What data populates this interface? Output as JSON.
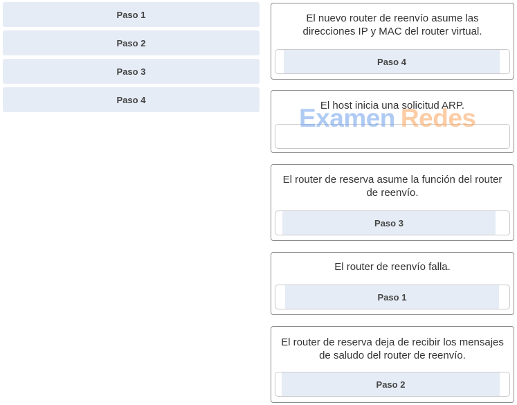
{
  "source_items": [
    {
      "label": "Paso 1"
    },
    {
      "label": "Paso 2"
    },
    {
      "label": "Paso 3"
    },
    {
      "label": "Paso 4"
    }
  ],
  "targets": [
    {
      "text": "El nuevo router de reenvío asume las direcciones IP y MAC del router virtual.",
      "answer": "Paso 4"
    },
    {
      "text": "El host inicia una solicitud ARP.",
      "answer": ""
    },
    {
      "text": "El router de reserva asume la función del router de reenvío.",
      "answer": "Paso 3"
    },
    {
      "text": "El router de reenvío falla.",
      "answer": "Paso 1"
    },
    {
      "text": "El router de reserva deja de recibir los mensajes de saludo del router de reenvío.",
      "answer": "Paso 2"
    }
  ],
  "watermark": {
    "word1": "Examen",
    "word2": "Redes"
  }
}
